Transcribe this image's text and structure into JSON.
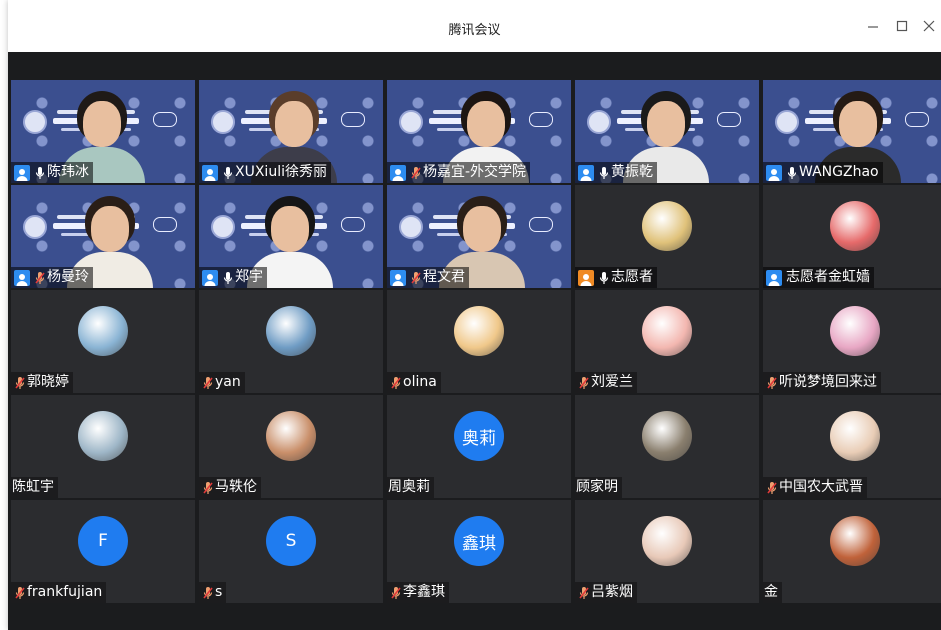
{
  "window": {
    "title": "腾讯会议",
    "minimize_icon": "minimize-icon",
    "maximize_icon": "maximize-icon",
    "close_icon": "close-icon"
  },
  "participants": [
    {
      "name": "陈玮冰",
      "kind": "video",
      "mic": "on",
      "shirt": "#a9c7c0",
      "hair": "#1f1a17"
    },
    {
      "name": "XUXiuli徐秀丽",
      "kind": "video",
      "mic": "on",
      "shirt": "#3d3d4a",
      "hair": "#5a3d2a"
    },
    {
      "name": "杨嘉宜-外交学院",
      "kind": "video",
      "mic": "muted",
      "shirt": "#f2f2f2",
      "hair": "#1c1512"
    },
    {
      "name": "黄振乾",
      "kind": "video",
      "mic": "on",
      "shirt": "#e9e9e9",
      "hair": "#1a1a1a"
    },
    {
      "name": "WANGZhao",
      "kind": "video",
      "mic": "on",
      "shirt": "#2b2b2b",
      "hair": "#241a14"
    },
    {
      "name": "杨曼玲",
      "kind": "video",
      "mic": "muted",
      "shirt": "#f0ece4",
      "hair": "#2a1e17"
    },
    {
      "name": "郑宇",
      "kind": "video",
      "mic": "on",
      "shirt": "#f4f4f4",
      "hair": "#161616"
    },
    {
      "name": "程文君",
      "kind": "video",
      "mic": "muted",
      "shirt": "#d8c6b2",
      "hair": "#2a1f18"
    },
    {
      "name": "志愿者",
      "kind": "avatar",
      "mic": "on",
      "user_icon": "orange",
      "avatar_color": "#e0c27a"
    },
    {
      "name": "志愿者金虹嫱",
      "kind": "avatar",
      "mic": "none",
      "user_icon": "blue",
      "avatar_color": "#e66a6a"
    },
    {
      "name": "郭晓婷",
      "kind": "avatar",
      "mic": "muted",
      "avatar_color": "#8ab4d4"
    },
    {
      "name": "yan",
      "kind": "avatar",
      "mic": "muted",
      "avatar_color": "#6f9cc4"
    },
    {
      "name": "olina",
      "kind": "avatar",
      "mic": "muted",
      "avatar_color": "#f0c88a"
    },
    {
      "name": "刘爱兰",
      "kind": "avatar",
      "mic": "muted",
      "avatar_color": "#f3b7b0"
    },
    {
      "name": "听说梦境回来过",
      "kind": "avatar",
      "mic": "muted",
      "avatar_color": "#e8a7c4"
    },
    {
      "name": "陈虹宇",
      "kind": "avatar",
      "mic": "none",
      "avatar_color": "#9fb7c8"
    },
    {
      "name": "马轶伦",
      "kind": "avatar",
      "mic": "muted",
      "avatar_color": "#c98f6a"
    },
    {
      "name": "周奥莉",
      "kind": "letter",
      "mic": "none",
      "letter": "奥莉"
    },
    {
      "name": "顾家明",
      "kind": "avatar",
      "mic": "none",
      "avatar_color": "#8a7f6e"
    },
    {
      "name": "中国农大武晋",
      "kind": "avatar",
      "mic": "muted",
      "avatar_color": "#e9cdb6"
    },
    {
      "name": "frankfujian",
      "kind": "letter",
      "mic": "muted",
      "letter": "F"
    },
    {
      "name": "s",
      "kind": "letter",
      "mic": "muted",
      "letter": "S"
    },
    {
      "name": "李鑫琪",
      "kind": "letter",
      "mic": "muted",
      "letter": "鑫琪"
    },
    {
      "name": "吕紫烟",
      "kind": "avatar",
      "mic": "muted",
      "avatar_color": "#e8c9b8"
    },
    {
      "name": "金",
      "kind": "avatar",
      "mic": "none",
      "avatar_color": "#c0623a"
    }
  ]
}
